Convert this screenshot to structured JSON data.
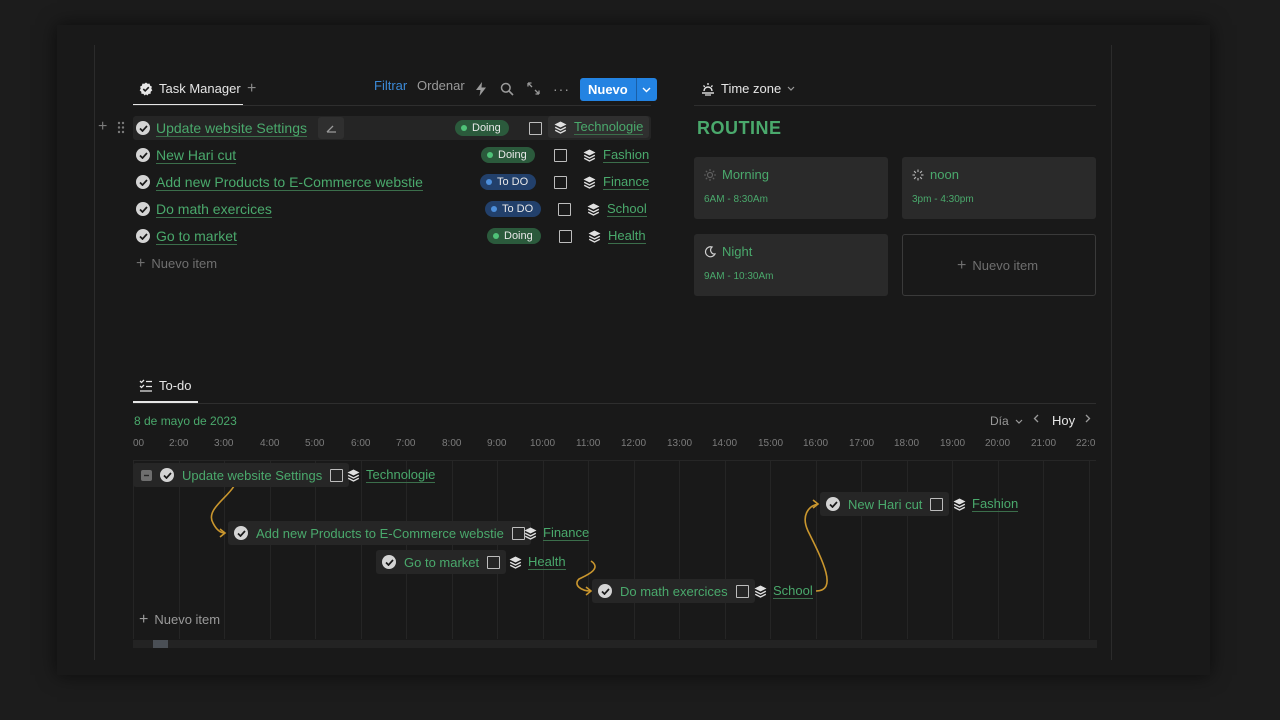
{
  "colors": {
    "accent_green": "#4aa96c",
    "brand_blue": "#2383e2",
    "doing_pill": "#2b5a3c",
    "todo_pill": "#22406b",
    "background": "#191919"
  },
  "task_manager": {
    "tab_label": "Task Manager",
    "tab_icon": "checkmark-badge-icon",
    "add_tab_icon": "plus-icon",
    "toolbar": {
      "filter_label": "Filtrar",
      "sort_label": "Ordenar",
      "icons": [
        "lightning-icon",
        "search-icon",
        "expand-icon",
        "more-icon"
      ],
      "new_button_label": "Nuevo"
    },
    "tasks": [
      {
        "title": "Update website Settings",
        "status": "Doing",
        "category": "Technologie"
      },
      {
        "title": "New Hari cut",
        "status": "Doing",
        "category": "Fashion"
      },
      {
        "title": "Add new Products to E-Commerce webstie",
        "status": "To DO",
        "category": "Finance"
      },
      {
        "title": "Do math exercices",
        "status": "To DO",
        "category": "School"
      },
      {
        "title": "Go to market",
        "status": "Doing",
        "category": "Health"
      }
    ],
    "new_item_label": "Nuevo item"
  },
  "routine": {
    "tab_label": "Time zone",
    "tab_icon": "sunrise-icon",
    "title": "ROUTINE",
    "cards": [
      {
        "title": "Morning",
        "time": "6AM - 8:30Am",
        "icon": "sun-icon"
      },
      {
        "title": "noon",
        "time": "3pm - 4:30pm",
        "icon": "loading-icon"
      },
      {
        "title": "Night",
        "time": "9AM - 10:30Am",
        "icon": "moon-icon"
      }
    ],
    "new_item_label": "Nuevo item"
  },
  "todo": {
    "tab_label": "To-do",
    "tab_icon": "checklist-icon",
    "date": "8 de mayo de 2023",
    "view_label": "Día",
    "today_label": "Hoy",
    "hours": [
      "00",
      "2:00",
      "3:00",
      "4:00",
      "5:00",
      "6:00",
      "7:00",
      "8:00",
      "9:00",
      "10:00",
      "11:00",
      "12:00",
      "13:00",
      "14:00",
      "15:00",
      "16:00",
      "17:00",
      "18:00",
      "19:00",
      "20:00",
      "21:00",
      "22:0"
    ],
    "items": [
      {
        "title": "Update website Settings",
        "category": "Technologie"
      },
      {
        "title": "Add new Products to E-Commerce webstie",
        "category": "Finance"
      },
      {
        "title": "Go to market",
        "category": "Health"
      },
      {
        "title": "Do math exercices",
        "category": "School"
      },
      {
        "title": "New Hari cut",
        "category": "Fashion"
      }
    ],
    "new_item_label": "Nuevo item"
  }
}
